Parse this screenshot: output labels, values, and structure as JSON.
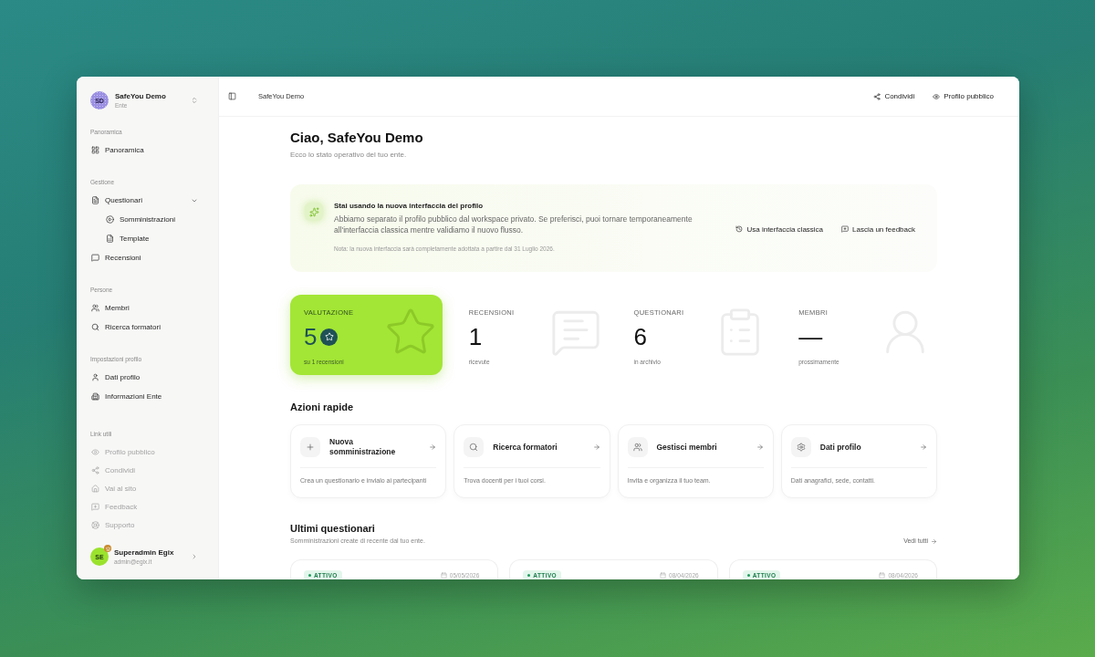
{
  "workspace": {
    "initials": "SD",
    "name": "SafeYou Demo",
    "type": "Ente"
  },
  "sidebar": {
    "groups": [
      {
        "label": "Panoramica",
        "items": [
          {
            "label": "Panoramica",
            "muted": false
          }
        ]
      },
      {
        "label": "Gestione",
        "items": [
          {
            "label": "Questionari",
            "muted": false,
            "expanded": true,
            "children": [
              {
                "label": "Somministrazioni",
                "muted": false
              },
              {
                "label": "Template",
                "muted": false
              }
            ]
          },
          {
            "label": "Recensioni",
            "muted": false
          }
        ]
      },
      {
        "label": "Persone",
        "items": [
          {
            "label": "Membri",
            "muted": false
          },
          {
            "label": "Ricerca formatori",
            "muted": false
          }
        ]
      },
      {
        "label": "Impostazioni profilo",
        "items": [
          {
            "label": "Dati profilo",
            "muted": false
          },
          {
            "label": "Informazioni Ente",
            "muted": false
          }
        ]
      },
      {
        "label": "Link utili",
        "items": [
          {
            "label": "Profilo pubblico",
            "muted": true
          },
          {
            "label": "Condividi",
            "muted": true
          },
          {
            "label": "Vai al sito",
            "muted": true
          },
          {
            "label": "Feedback",
            "muted": true
          },
          {
            "label": "Supporto",
            "muted": true
          }
        ]
      }
    ]
  },
  "user": {
    "initials": "SE",
    "name": "Superadmin Egix",
    "email": "admin@egix.it"
  },
  "topbar": {
    "breadcrumb": "SafeYou Demo",
    "actions": [
      "Condividi",
      "Profilo pubblico"
    ]
  },
  "header": {
    "title": "Ciao, SafeYou Demo",
    "subtitle": "Ecco lo stato operativo del tuo ente."
  },
  "notice": {
    "title": "Stai usando la nuova interfaccia del profilo",
    "body": "Abbiamo separato il profilo pubblico dal workspace privato. Se preferisci, puoi tornare temporaneamente all'interfaccia classica mentre validiamo il nuovo flusso.",
    "note": "Nota: la nuova interfaccia sarà completamente adottata a partire dal 31 Luglio 2026.",
    "actions": [
      "Usa interfaccia classica",
      "Lascia un feedback"
    ]
  },
  "stats": [
    {
      "label": "VALUTAZIONE",
      "value": "5",
      "caption": "su 1 recensioni",
      "highlighted": true
    },
    {
      "label": "RECENSIONI",
      "value": "1",
      "caption": "ricevute",
      "highlighted": false
    },
    {
      "label": "QUESTIONARI",
      "value": "6",
      "caption": "in archivio",
      "highlighted": false
    },
    {
      "label": "MEMBRI",
      "value": "—",
      "caption": "prossimamente",
      "highlighted": false
    }
  ],
  "quick_actions": {
    "title": "Azioni rapide",
    "items": [
      {
        "title": "Nuova somministrazione",
        "description": "Crea un questionario e invialo ai partecipanti"
      },
      {
        "title": "Ricerca formatori",
        "description": "Trova docenti per i tuoi corsi."
      },
      {
        "title": "Gestisci membri",
        "description": "Invita e organizza il tuo team."
      },
      {
        "title": "Dati profilo",
        "description": "Dati anagrafici, sede, contatti."
      }
    ]
  },
  "recent": {
    "title": "Ultimi questionari",
    "subtitle": "Somministrazioni create di recente dal tuo ente.",
    "link": "Vedi tutti",
    "items": [
      {
        "status": "ATTIVO",
        "date": "05/05/2026"
      },
      {
        "status": "ATTIVO",
        "date": "08/04/2026"
      },
      {
        "status": "ATTIVO",
        "date": "08/04/2026"
      }
    ]
  }
}
